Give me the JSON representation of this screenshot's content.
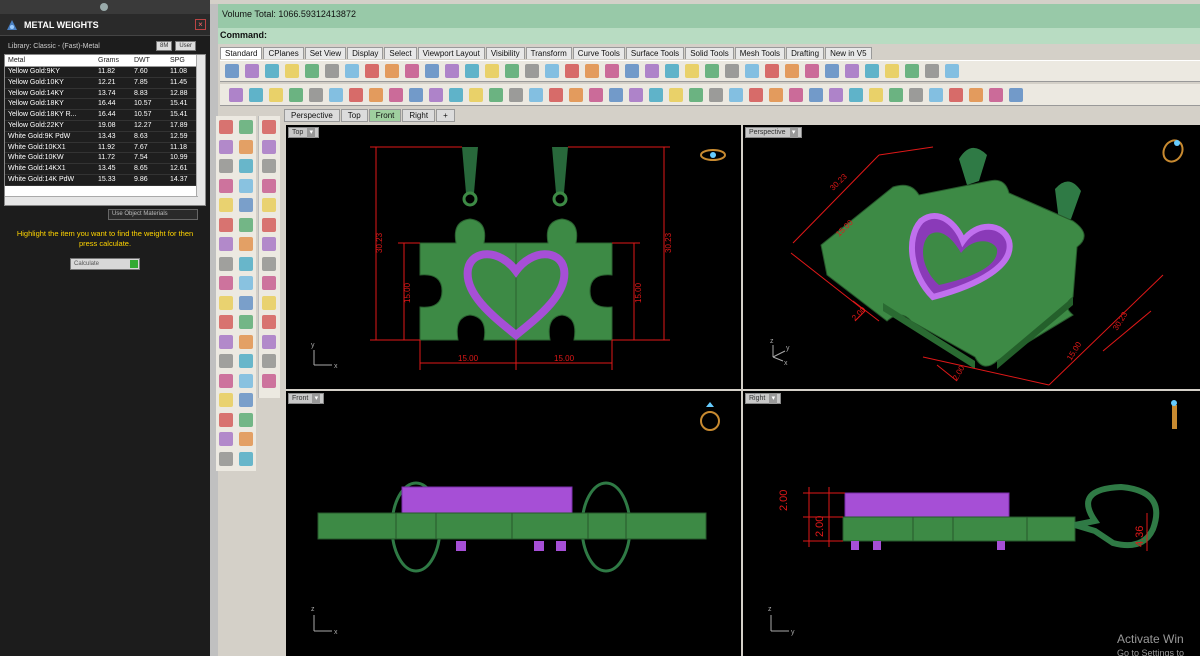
{
  "panel": {
    "title": "METAL WEIGHTS",
    "library": "Library: Classic - (Fast)-Metal",
    "unit_select": "8M",
    "user_select": "User",
    "columns": [
      "Metal",
      "Grams",
      "DWT",
      "SPG"
    ],
    "rows": [
      [
        "Yellow Gold:9KY",
        "11.82",
        "7.60",
        "11.08"
      ],
      [
        "Yellow Gold:10KY",
        "12.21",
        "7.85",
        "11.45"
      ],
      [
        "Yellow Gold:14KY",
        "13.74",
        "8.83",
        "12.88"
      ],
      [
        "Yellow Gold:18KY",
        "16.44",
        "10.57",
        "15.41"
      ],
      [
        "Yellow Gold:18KY R...",
        "16.44",
        "10.57",
        "15.41"
      ],
      [
        "Yellow Gold:22KY",
        "19.08",
        "12.27",
        "17.89"
      ],
      [
        "White Gold:9K PdW",
        "13.43",
        "8.63",
        "12.59"
      ],
      [
        "White Gold:10KX1",
        "11.92",
        "7.67",
        "11.18"
      ],
      [
        "White Gold:10KW",
        "11.72",
        "7.54",
        "10.99"
      ],
      [
        "White Gold:14KX1",
        "13.45",
        "8.65",
        "12.61"
      ],
      [
        "White Gold:14K PdW",
        "15.33",
        "9.86",
        "14.37"
      ]
    ],
    "object_materials": "Use Object Materials",
    "hint": "Highlight the item you want to find the weight for then press calculate.",
    "calculate": "Calculate"
  },
  "volume_total": "Volume Total: 1066.59312413872",
  "command_label": "Command:",
  "toolbar_tabs": [
    "Standard",
    "CPlanes",
    "Set View",
    "Display",
    "Select",
    "Viewport Layout",
    "Visibility",
    "Transform",
    "Curve Tools",
    "Surface Tools",
    "Solid Tools",
    "Mesh Tools",
    "Drafting",
    "New in V5"
  ],
  "viewport_tabs": [
    "Perspective",
    "Top",
    "Front",
    "Right"
  ],
  "viewports": {
    "top": {
      "label": "Top",
      "dim_height": "30.23",
      "dim_inner": "15.00",
      "dim_width_left": "15.00",
      "dim_width_right": "15.00",
      "axis_y": "y",
      "axis_x": "x"
    },
    "perspective": {
      "label": "Perspective",
      "dim_a": "30.23",
      "dim_b": "15.00",
      "dim_c": "30.23",
      "dim_d": "15.00",
      "dim_e": "2.00",
      "dim_f": "2.00",
      "axis_z": "z",
      "axis_y": "y",
      "axis_x": "x"
    },
    "front": {
      "label": "Front",
      "axis_z": "z",
      "axis_x": "x"
    },
    "right": {
      "label": "Right",
      "dim_top": "2.00",
      "dim_bottom": "2.00",
      "dim_loop": "4.36",
      "axis_z": "z",
      "axis_y": "y"
    }
  },
  "watermark": {
    "line1": "Activate Win",
    "line2": "Go to Settings to"
  },
  "colors": {
    "model_green": "#3d8a45",
    "model_purple": "#a64fd6",
    "dim_red": "#e01818",
    "vp_bg": "#000000",
    "cmd_bar": "#98c9a8"
  }
}
